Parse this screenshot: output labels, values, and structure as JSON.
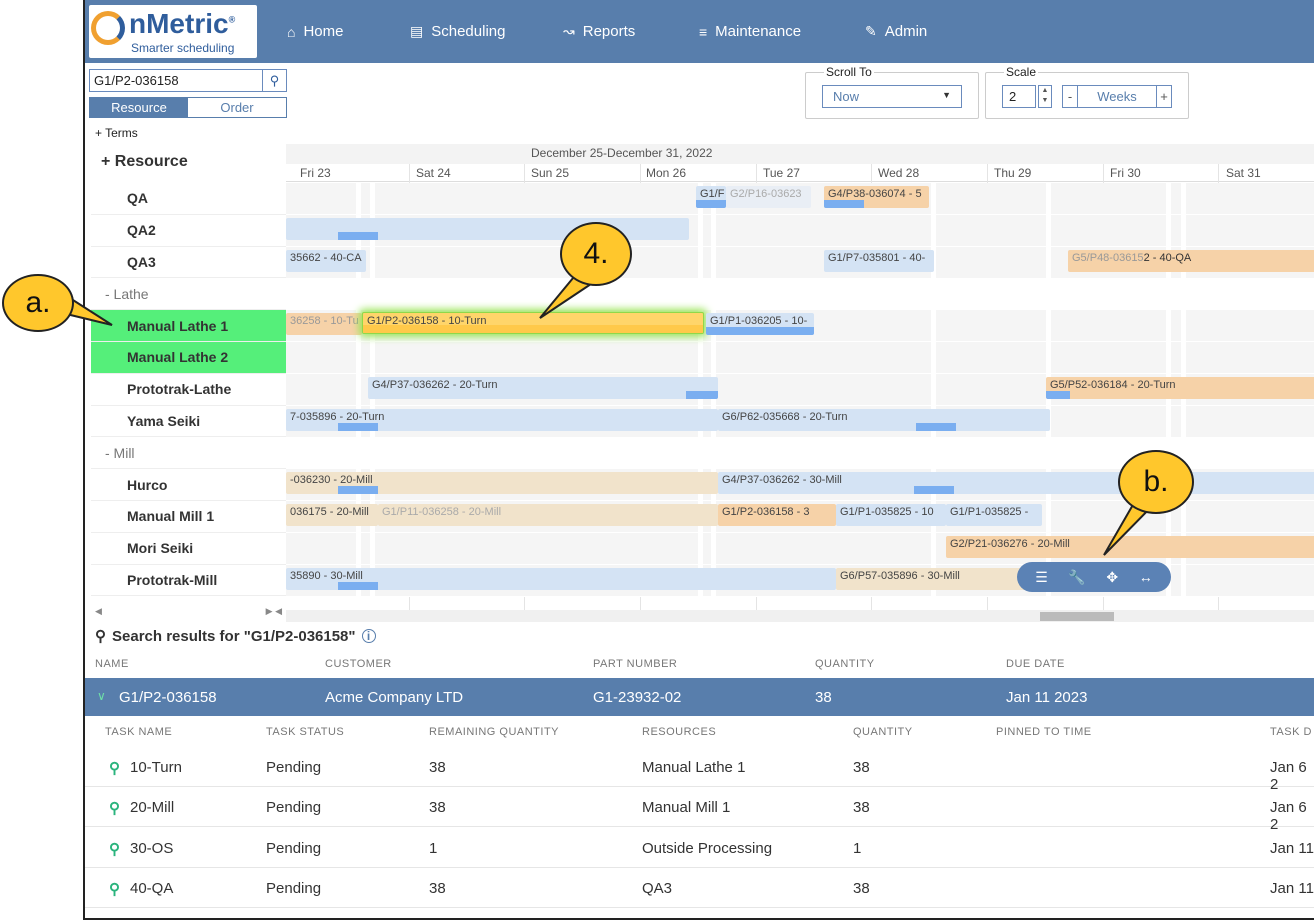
{
  "header": {
    "brand": "nMetric",
    "brand_mark": "®",
    "tagline": "Smarter scheduling",
    "nav": [
      {
        "label": "Home",
        "icon": "home-icon"
      },
      {
        "label": "Scheduling",
        "icon": "calendar-icon"
      },
      {
        "label": "Reports",
        "icon": "chart-icon"
      },
      {
        "label": "Maintenance",
        "icon": "sliders-icon"
      },
      {
        "label": "Admin",
        "icon": "edit-icon"
      }
    ]
  },
  "search": {
    "value": "G1/P2-036158"
  },
  "toggle": {
    "resource": "Resource",
    "order": "Order"
  },
  "terms": "+  Terms",
  "resource_header": "+ Resource",
  "rows": [
    {
      "label": "QA",
      "kind": "res"
    },
    {
      "label": "QA2",
      "kind": "res"
    },
    {
      "label": "QA3",
      "kind": "res"
    },
    {
      "label": "- Lathe",
      "kind": "grp"
    },
    {
      "label": "Manual Lathe 1",
      "kind": "res",
      "highlight": true
    },
    {
      "label": "Manual Lathe 2",
      "kind": "res",
      "highlight": true
    },
    {
      "label": "Prototrak-Lathe",
      "kind": "res"
    },
    {
      "label": "Yama Seiki",
      "kind": "res"
    },
    {
      "label": "- Mill",
      "kind": "grp"
    },
    {
      "label": "Hurco",
      "kind": "res"
    },
    {
      "label": "Manual Mill 1",
      "kind": "res"
    },
    {
      "label": "Mori Seiki",
      "kind": "res"
    },
    {
      "label": "Prototrak-Mill",
      "kind": "res"
    }
  ],
  "scroll_to": {
    "label": "Scroll To",
    "value": "Now"
  },
  "scale": {
    "label": "Scale",
    "value": "2",
    "unit": "Weeks",
    "minus": "-",
    "plus": "+"
  },
  "week_title": "December 25-December 31, 2022",
  "days": [
    "Fri 23",
    "Sat 24",
    "Sun 25",
    "Mon 26",
    "Tue 27",
    "Wed 28",
    "Thu 29",
    "Fri 30",
    "Sat 31"
  ],
  "bars": {
    "qa_1": "G1/F",
    "qa_2": "G2/P16-03623",
    "qa_3": "G4/P38-036074 - 5",
    "qa3_1": "35662 - 40-CA",
    "qa3_2": "G1/P7-035801 - 40-",
    "qa3_3": "G5/P48-03615",
    "qa3_3b": "2 - 40-QA",
    "ml1_1": "36258 - 10-Tu",
    "ml1_2": "G1/P2-036158 - 10-Turn",
    "ml1_3": "G1/P1-036205 - 10-",
    "pl_1": "G4/P37-036262 - 20-Turn",
    "pl_2": "G5/P52-036184 - 20-Turn",
    "ys_1": "7-035896 - 20-Turn",
    "ys_2": "G6/P62-035668 - 20-Turn",
    "hu_1": "-036230 - 20-Mill",
    "hu_2": "G4/P37-036262 - 30-Mill",
    "mm1_1": "036175 - 20-Mill",
    "mm1_2": "G1/P11-036258 - 20-Mill",
    "mm1_3": "G1/P2-036158 - 3",
    "mm1_4": "G1/P1-035825 - 10",
    "mm1_5": "G1/P1-035825 -",
    "ms_1": "G2/P21-036276 - 20-Mill",
    "pm_1": "35890 - 30-Mill",
    "pm_2": "G6/P57-035896 - 30-Mill"
  },
  "results": {
    "title": "Search results for \"G1/P2-036158\"",
    "order_headers": [
      "NAME",
      "CUSTOMER",
      "PART NUMBER",
      "QUANTITY",
      "DUE DATE"
    ],
    "order": {
      "name": "G1/P2-036158",
      "customer": "Acme Company LTD",
      "part": "G1-23932-02",
      "quantity": "38",
      "due": "Jan 11 2023"
    },
    "task_headers": [
      "TASK NAME",
      "TASK STATUS",
      "REMAINING QUANTITY",
      "RESOURCES",
      "QUANTITY",
      "PINNED TO TIME",
      "TASK D"
    ],
    "tasks": [
      {
        "name": "10-Turn",
        "status": "Pending",
        "remaining": "38",
        "resource": "Manual Lathe 1",
        "quantity": "38",
        "date": "Jan 6 2"
      },
      {
        "name": "20-Mill",
        "status": "Pending",
        "remaining": "38",
        "resource": "Manual Mill 1",
        "quantity": "38",
        "date": "Jan 6 2"
      },
      {
        "name": "30-OS",
        "status": "Pending",
        "remaining": "1",
        "resource": "Outside Processing",
        "quantity": "1",
        "date": "Jan 11"
      },
      {
        "name": "40-QA",
        "status": "Pending",
        "remaining": "38",
        "resource": "QA3",
        "quantity": "38",
        "date": "Jan 11"
      }
    ]
  },
  "callouts": {
    "a": "a.",
    "b": "b.",
    "four": "4."
  },
  "colors": {
    "header": "#587eac",
    "highlight": "#55ef7a",
    "callout": "#ffc72c",
    "bar_blue": "#d4e3f4",
    "bar_orange": "#f6d2a8",
    "bar_gold": "#ffd56a"
  }
}
